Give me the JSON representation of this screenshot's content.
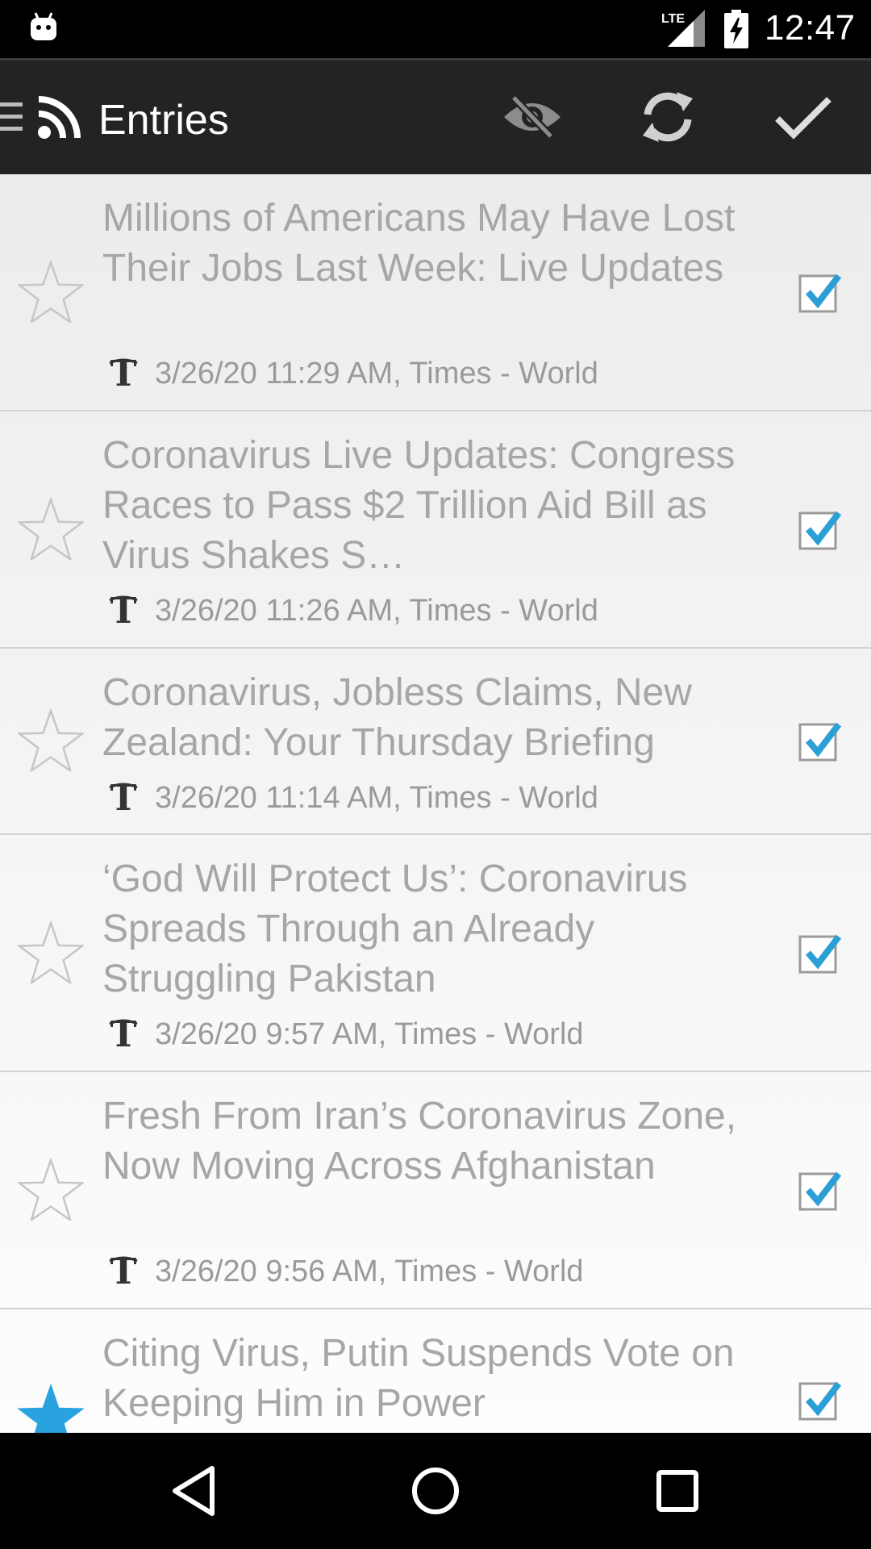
{
  "status_bar": {
    "time": "12:47",
    "network_label": "LTE",
    "icons": [
      "android-robot-icon",
      "lte-signal-icon",
      "battery-charging-icon"
    ]
  },
  "toolbar": {
    "title": "Entries",
    "icons": [
      "hamburger-menu-icon",
      "rss-feed-icon",
      "hide-read-icon",
      "refresh-icon",
      "mark-all-read-icon"
    ]
  },
  "entries": [
    {
      "title": "Millions of Americans May Have Lost Their Jobs Last Week: Live Updates",
      "meta": "3/26/20 11:29 AM, Times - World",
      "starred": false,
      "checked": true
    },
    {
      "title": "Coronavirus Live Updates: Congress Races to Pass $2 Trillion Aid Bill as Virus Shakes S…",
      "meta": "3/26/20 11:26 AM, Times - World",
      "starred": false,
      "checked": true
    },
    {
      "title": "Coronavirus, Jobless Claims, New Zealand: Your Thursday Briefing",
      "meta": "3/26/20 11:14 AM, Times - World",
      "starred": false,
      "checked": true
    },
    {
      "title": "‘God Will Protect Us’: Coronavirus Spreads Through an Already Struggling Pakistan",
      "meta": "3/26/20 9:57 AM, Times - World",
      "starred": false,
      "checked": true
    },
    {
      "title": "Fresh From Iran’s Coronavirus Zone, Now Moving Across Afghanistan",
      "meta": "3/26/20 9:56 AM, Times - World",
      "starred": false,
      "checked": true
    },
    {
      "title": "Citing Virus, Putin Suspends Vote on Keeping Him in Power",
      "meta": "",
      "starred": true,
      "checked": true
    }
  ],
  "nav_bar": {
    "icons": [
      "back-icon",
      "home-icon",
      "recents-icon"
    ]
  },
  "colors": {
    "star_active": "#29a3e0",
    "check_accent": "#2b9fd6",
    "toolbar_bg": "#232323",
    "title_text": "#a6a6a6"
  }
}
